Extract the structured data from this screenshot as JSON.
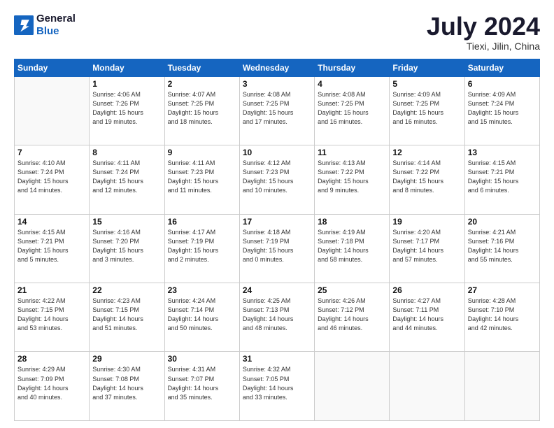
{
  "header": {
    "logo_line1": "General",
    "logo_line2": "Blue",
    "month_year": "July 2024",
    "location": "Tiexi, Jilin, China"
  },
  "weekdays": [
    "Sunday",
    "Monday",
    "Tuesday",
    "Wednesday",
    "Thursday",
    "Friday",
    "Saturday"
  ],
  "weeks": [
    [
      {
        "day": "",
        "empty": true
      },
      {
        "day": "1",
        "sunrise": "4:06 AM",
        "sunset": "7:26 PM",
        "daylight": "15 hours and 19 minutes."
      },
      {
        "day": "2",
        "sunrise": "4:07 AM",
        "sunset": "7:25 PM",
        "daylight": "15 hours and 18 minutes."
      },
      {
        "day": "3",
        "sunrise": "4:08 AM",
        "sunset": "7:25 PM",
        "daylight": "15 hours and 17 minutes."
      },
      {
        "day": "4",
        "sunrise": "4:08 AM",
        "sunset": "7:25 PM",
        "daylight": "15 hours and 16 minutes."
      },
      {
        "day": "5",
        "sunrise": "4:09 AM",
        "sunset": "7:25 PM",
        "daylight": "15 hours and 16 minutes."
      },
      {
        "day": "6",
        "sunrise": "4:09 AM",
        "sunset": "7:24 PM",
        "daylight": "15 hours and 15 minutes."
      }
    ],
    [
      {
        "day": "7",
        "sunrise": "4:10 AM",
        "sunset": "7:24 PM",
        "daylight": "15 hours and 14 minutes."
      },
      {
        "day": "8",
        "sunrise": "4:11 AM",
        "sunset": "7:24 PM",
        "daylight": "15 hours and 12 minutes."
      },
      {
        "day": "9",
        "sunrise": "4:11 AM",
        "sunset": "7:23 PM",
        "daylight": "15 hours and 11 minutes."
      },
      {
        "day": "10",
        "sunrise": "4:12 AM",
        "sunset": "7:23 PM",
        "daylight": "15 hours and 10 minutes."
      },
      {
        "day": "11",
        "sunrise": "4:13 AM",
        "sunset": "7:22 PM",
        "daylight": "15 hours and 9 minutes."
      },
      {
        "day": "12",
        "sunrise": "4:14 AM",
        "sunset": "7:22 PM",
        "daylight": "15 hours and 8 minutes."
      },
      {
        "day": "13",
        "sunrise": "4:15 AM",
        "sunset": "7:21 PM",
        "daylight": "15 hours and 6 minutes."
      }
    ],
    [
      {
        "day": "14",
        "sunrise": "4:15 AM",
        "sunset": "7:21 PM",
        "daylight": "15 hours and 5 minutes."
      },
      {
        "day": "15",
        "sunrise": "4:16 AM",
        "sunset": "7:20 PM",
        "daylight": "15 hours and 3 minutes."
      },
      {
        "day": "16",
        "sunrise": "4:17 AM",
        "sunset": "7:19 PM",
        "daylight": "15 hours and 2 minutes."
      },
      {
        "day": "17",
        "sunrise": "4:18 AM",
        "sunset": "7:19 PM",
        "daylight": "15 hours and 0 minutes."
      },
      {
        "day": "18",
        "sunrise": "4:19 AM",
        "sunset": "7:18 PM",
        "daylight": "14 hours and 58 minutes."
      },
      {
        "day": "19",
        "sunrise": "4:20 AM",
        "sunset": "7:17 PM",
        "daylight": "14 hours and 57 minutes."
      },
      {
        "day": "20",
        "sunrise": "4:21 AM",
        "sunset": "7:16 PM",
        "daylight": "14 hours and 55 minutes."
      }
    ],
    [
      {
        "day": "21",
        "sunrise": "4:22 AM",
        "sunset": "7:15 PM",
        "daylight": "14 hours and 53 minutes."
      },
      {
        "day": "22",
        "sunrise": "4:23 AM",
        "sunset": "7:15 PM",
        "daylight": "14 hours and 51 minutes."
      },
      {
        "day": "23",
        "sunrise": "4:24 AM",
        "sunset": "7:14 PM",
        "daylight": "14 hours and 50 minutes."
      },
      {
        "day": "24",
        "sunrise": "4:25 AM",
        "sunset": "7:13 PM",
        "daylight": "14 hours and 48 minutes."
      },
      {
        "day": "25",
        "sunrise": "4:26 AM",
        "sunset": "7:12 PM",
        "daylight": "14 hours and 46 minutes."
      },
      {
        "day": "26",
        "sunrise": "4:27 AM",
        "sunset": "7:11 PM",
        "daylight": "14 hours and 44 minutes."
      },
      {
        "day": "27",
        "sunrise": "4:28 AM",
        "sunset": "7:10 PM",
        "daylight": "14 hours and 42 minutes."
      }
    ],
    [
      {
        "day": "28",
        "sunrise": "4:29 AM",
        "sunset": "7:09 PM",
        "daylight": "14 hours and 40 minutes."
      },
      {
        "day": "29",
        "sunrise": "4:30 AM",
        "sunset": "7:08 PM",
        "daylight": "14 hours and 37 minutes."
      },
      {
        "day": "30",
        "sunrise": "4:31 AM",
        "sunset": "7:07 PM",
        "daylight": "14 hours and 35 minutes."
      },
      {
        "day": "31",
        "sunrise": "4:32 AM",
        "sunset": "7:05 PM",
        "daylight": "14 hours and 33 minutes."
      },
      {
        "day": "",
        "empty": true
      },
      {
        "day": "",
        "empty": true
      },
      {
        "day": "",
        "empty": true
      }
    ]
  ]
}
